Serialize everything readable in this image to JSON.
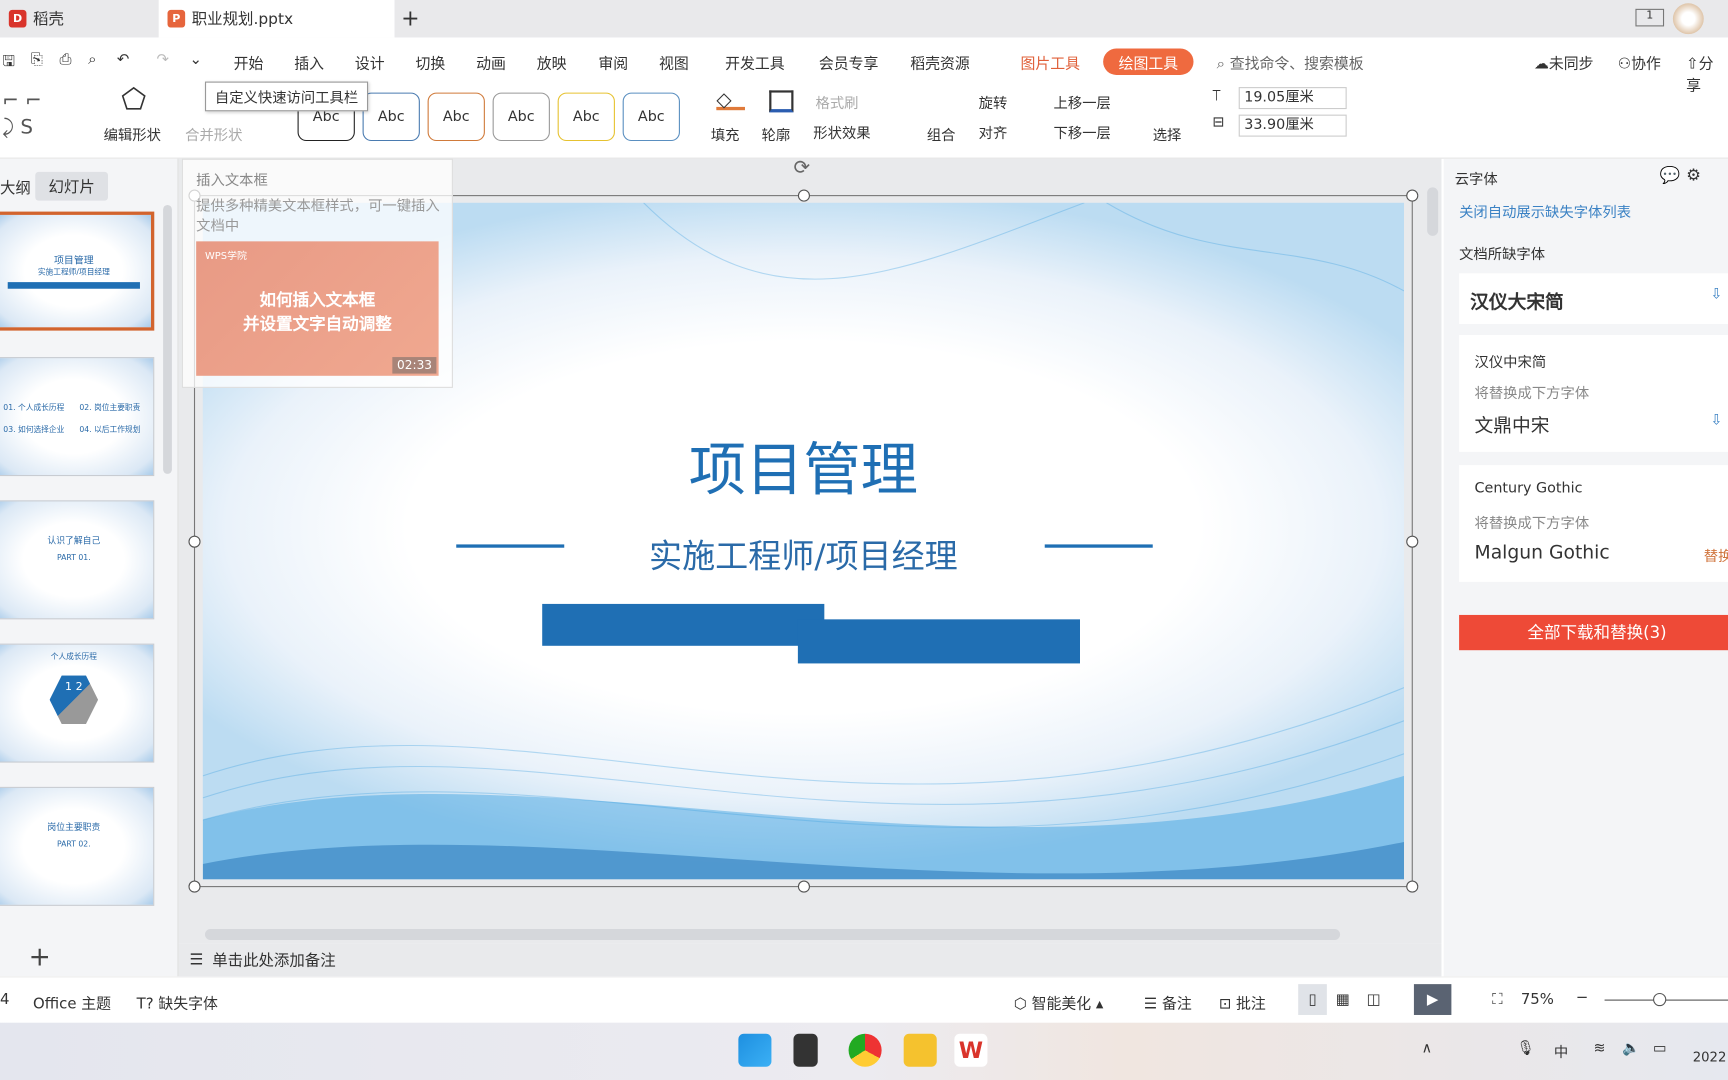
{
  "tabs": [
    {
      "label": "稻壳",
      "icon": "daoke-logo-icon"
    },
    {
      "label": "职业规划.pptx",
      "icon": "pptx-file-icon",
      "active": true
    }
  ],
  "new_tab": "+",
  "menu": {
    "items": [
      "开始",
      "插入",
      "设计",
      "切换",
      "动画",
      "放映",
      "审阅",
      "视图",
      "开发工具",
      "会员专享",
      "稻壳资源"
    ],
    "context_tabs": [
      "图片工具",
      "绘图工具"
    ],
    "search_placeholder": "查找命令、搜索模板",
    "sync": "未同步",
    "collab": "协作",
    "share": "分享"
  },
  "tooltip": "自定义快速访问工具栏",
  "ribbon": {
    "edit_shape": "编辑形状",
    "merge_shape": "合并形状",
    "style_samples": [
      "Abc",
      "Abc",
      "Abc",
      "Abc",
      "Abc",
      "Abc"
    ],
    "style_colors": [
      "#222222",
      "#4a7bb0",
      "#d07a3a",
      "#999999",
      "#e6c230",
      "#5a8fc0"
    ],
    "fill": "填充",
    "outline": "轮廓",
    "format_painter": "格式刷",
    "shape_effect": "形状效果",
    "group": "组合",
    "rotate": "旋转",
    "align": "对齐",
    "bring_forward": "上移一层",
    "send_backward": "下移一层",
    "select": "选择",
    "height": "19.05厘米",
    "width": "33.90厘米"
  },
  "left_panel": {
    "tab_outline": "大纲",
    "tab_slides": "幻灯片",
    "add": "+",
    "thumbs": [
      {
        "title": "项目管理",
        "sub": "实施工程师/项目经理"
      },
      {
        "items": [
          "01. 个人成长历程",
          "02. 岗位主要职责",
          "03. 如何选择企业",
          "04. 以后工作规划"
        ]
      },
      {
        "title": "认识了解自己",
        "sub": "PART 01."
      },
      {
        "title": "个人成长历程",
        "n1": "1",
        "n2": "2"
      },
      {
        "title": "岗位主要职责",
        "sub": "PART 02."
      }
    ]
  },
  "popup": {
    "title": "插入文本框",
    "desc": "提供多种精美文本框样式，可一键插入文档中",
    "video_brand": "WPS学院",
    "video_title_1": "如何插入文本框",
    "video_title_2": "并设置文字自动调整",
    "duration": "02:33"
  },
  "slide": {
    "title": "项目管理",
    "subtitle": "实施工程师/项目经理",
    "accent": "#1f6fb4"
  },
  "right_panel": {
    "header": "云字体",
    "close_link": "关闭自动展示缺失字体列表",
    "section": "文档所缺字体",
    "fonts": [
      {
        "name": "汉仪大宋简"
      },
      {
        "name": "汉仪中宋简",
        "hint": "将替换成下方字体",
        "replacement": "文鼎中宋"
      },
      {
        "name": "Century Gothic",
        "hint": "将替换成下方字体",
        "replacement": "Malgun Gothic",
        "action": "替换"
      }
    ],
    "download_all": "全部下载和替换(3)"
  },
  "notes": "单击此处添加备注",
  "status": {
    "page": "4",
    "theme": "Office 主题",
    "missing_font": "缺失字体",
    "beautify": "智能美化",
    "notes": "备注",
    "comment": "批注",
    "zoom": "75%",
    "zoom_level": 0.75
  },
  "taskbar": {
    "ime": "中",
    "clock": "2022"
  }
}
